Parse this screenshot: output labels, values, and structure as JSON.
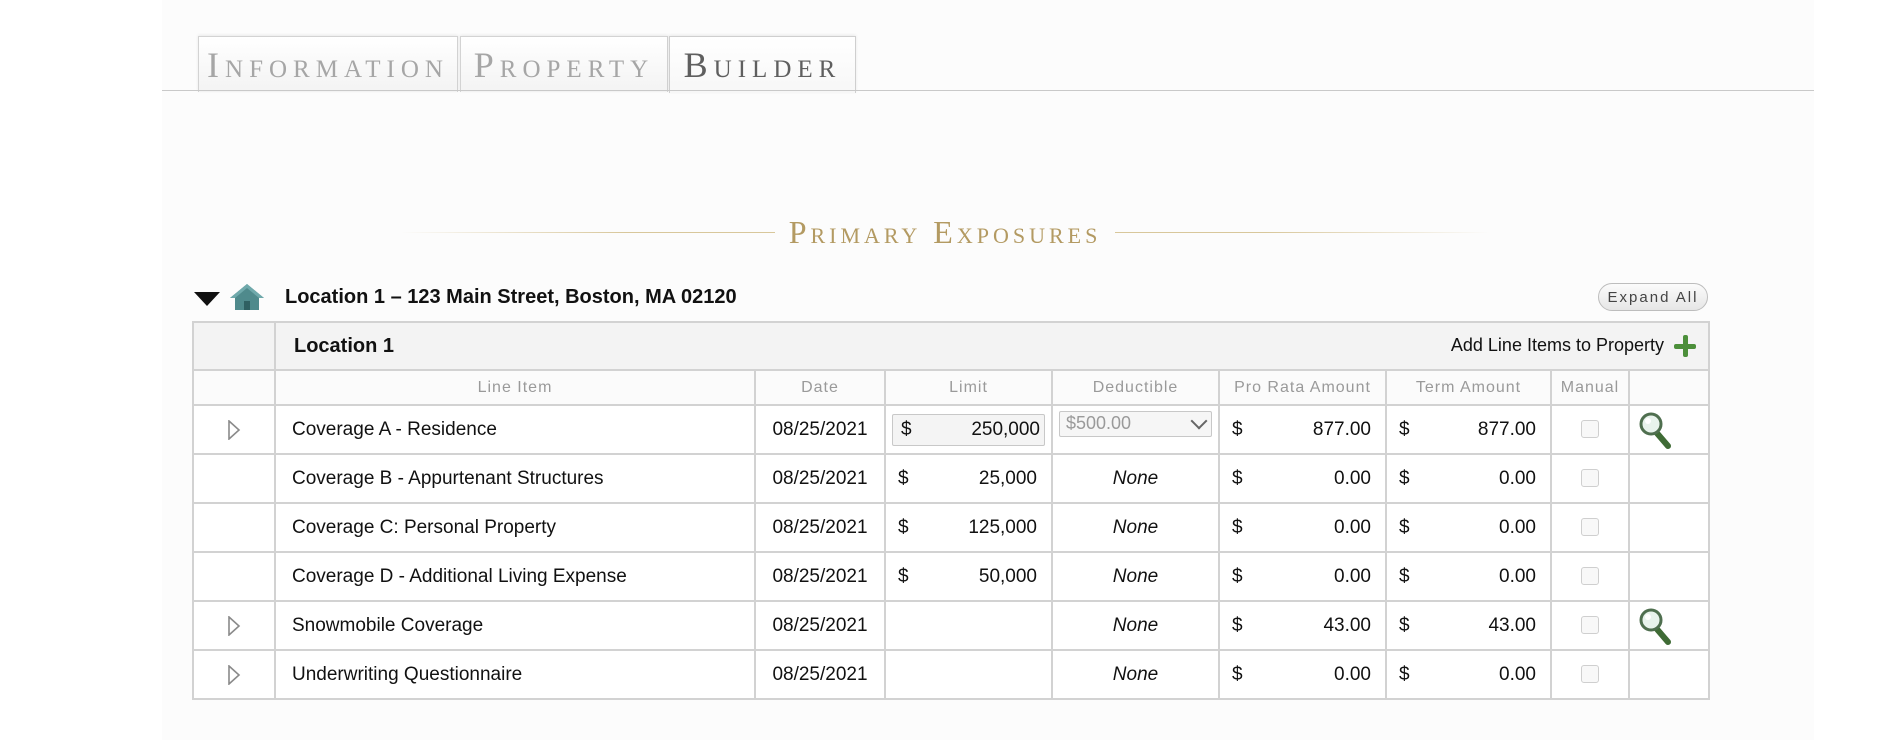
{
  "tabs": [
    {
      "label": "Information",
      "active": false
    },
    {
      "label": "Property",
      "active": false
    },
    {
      "label": "Builder",
      "active": true
    }
  ],
  "section_title": "Primary Exposures",
  "location_header": {
    "title": "Location 1 – 123 Main Street, Boston, MA 02120",
    "expand_all": "Expand All"
  },
  "table": {
    "location_name": "Location 1",
    "add_line_items": "Add Line Items to Property",
    "columns": {
      "line_item": "Line Item",
      "date": "Date",
      "limit": "Limit",
      "deductible": "Deductible",
      "pro_rata": "Pro Rata Amount",
      "term": "Term Amount",
      "manual": "Manual"
    },
    "currency": "$",
    "rows": [
      {
        "name": "Coverage A - Residence",
        "date": "08/25/2021",
        "limit": "250,000",
        "deductible": "$500.00",
        "pro_rata": "877.00",
        "term": "877.00"
      },
      {
        "name": "Coverage B - Appurtenant Structures",
        "date": "08/25/2021",
        "limit": "25,000",
        "deductible": "None",
        "pro_rata": "0.00",
        "term": "0.00"
      },
      {
        "name": "Coverage C: Personal Property",
        "date": "08/25/2021",
        "limit": "125,000",
        "deductible": "None",
        "pro_rata": "0.00",
        "term": "0.00"
      },
      {
        "name": "Coverage D - Additional Living Expense",
        "date": "08/25/2021",
        "limit": "50,000",
        "deductible": "None",
        "pro_rata": "0.00",
        "term": "0.00"
      },
      {
        "name": "Snowmobile Coverage",
        "date": "08/25/2021",
        "limit": "",
        "deductible": "None",
        "pro_rata": "43.00",
        "term": "43.00"
      },
      {
        "name": "Underwriting Questionnaire",
        "date": "08/25/2021",
        "limit": "",
        "deductible": "None",
        "pro_rata": "0.00",
        "term": "0.00"
      }
    ]
  },
  "colors": {
    "accent_gold": "#b39a62",
    "plus_green": "#4c8f3a",
    "house_teal": "#4f8a8c"
  }
}
